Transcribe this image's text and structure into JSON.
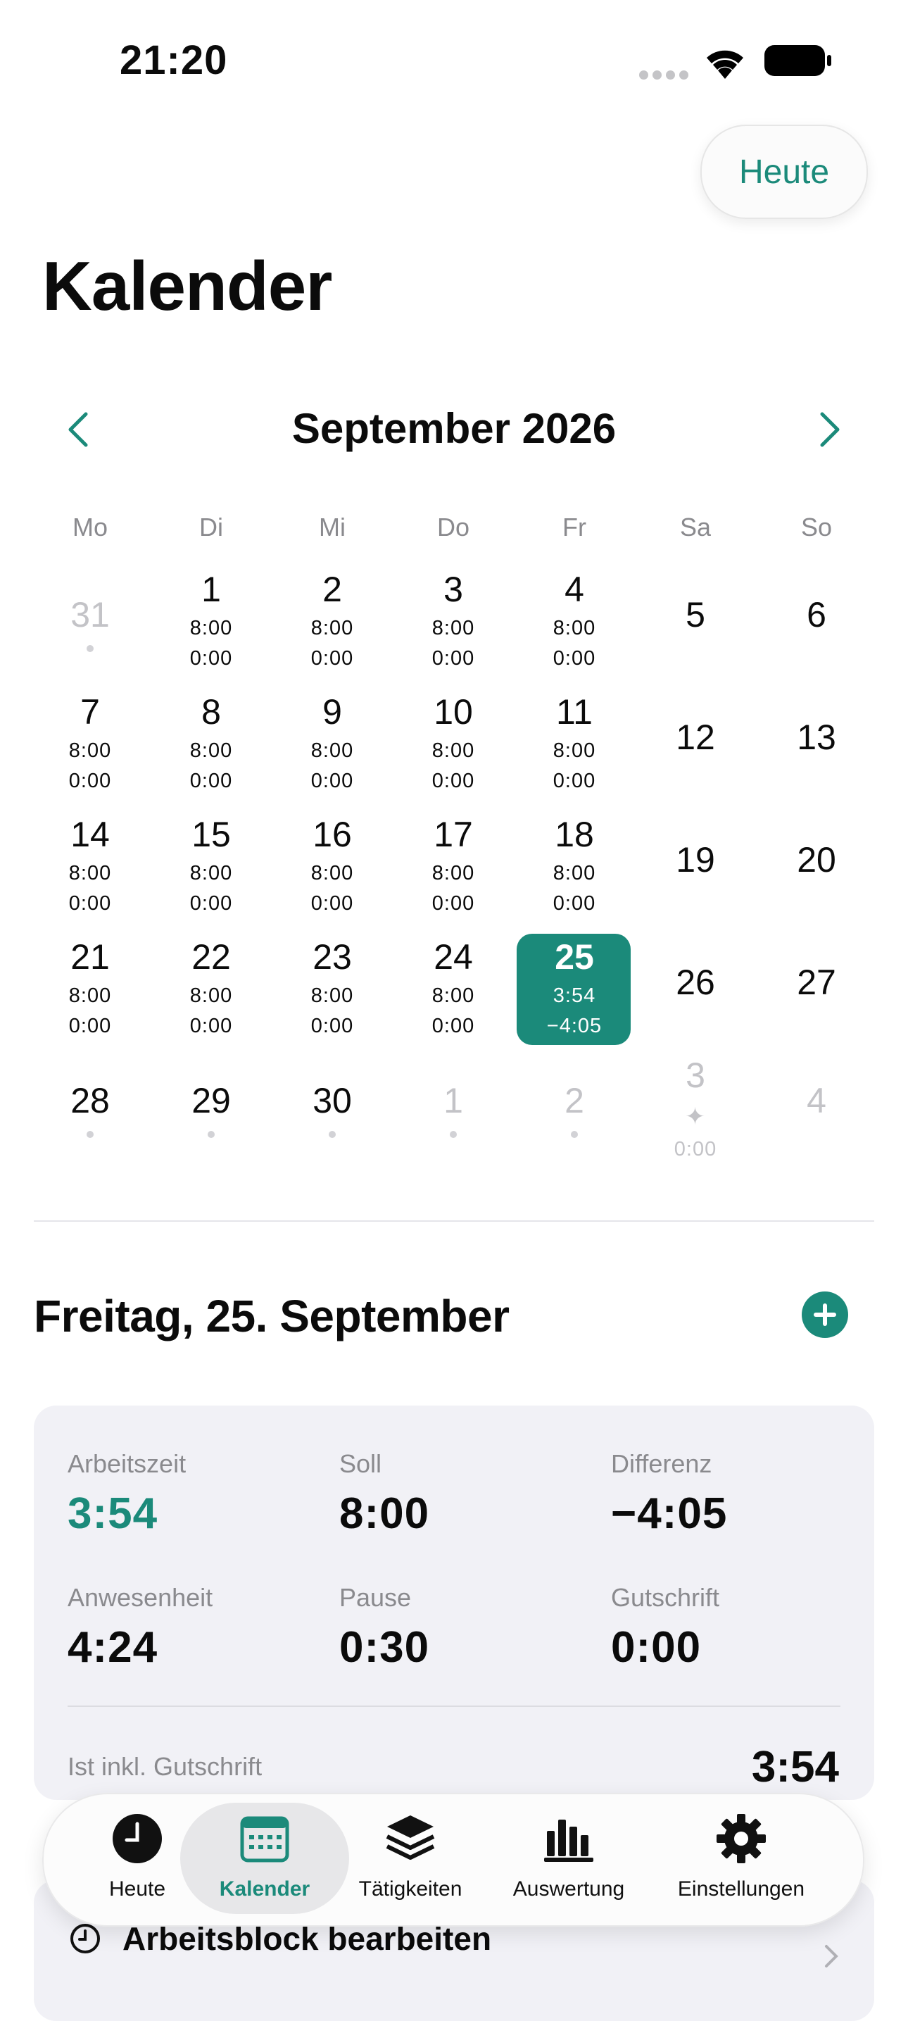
{
  "status_bar": {
    "time": "21:20"
  },
  "header": {
    "today_button": "Heute",
    "title": "Kalender"
  },
  "calendar": {
    "month_label": "September 2026",
    "weekdays": [
      "Mo",
      "Di",
      "Mi",
      "Do",
      "Fr",
      "Sa",
      "So"
    ],
    "weeks": [
      [
        {
          "day": "31",
          "muted": true,
          "dot": true
        },
        {
          "day": "1",
          "target": "8:00",
          "actual": "0:00"
        },
        {
          "day": "2",
          "target": "8:00",
          "actual": "0:00"
        },
        {
          "day": "3",
          "target": "8:00",
          "actual": "0:00"
        },
        {
          "day": "4",
          "target": "8:00",
          "actual": "0:00"
        },
        {
          "day": "5"
        },
        {
          "day": "6"
        }
      ],
      [
        {
          "day": "7",
          "target": "8:00",
          "actual": "0:00"
        },
        {
          "day": "8",
          "target": "8:00",
          "actual": "0:00"
        },
        {
          "day": "9",
          "target": "8:00",
          "actual": "0:00"
        },
        {
          "day": "10",
          "target": "8:00",
          "actual": "0:00"
        },
        {
          "day": "11",
          "target": "8:00",
          "actual": "0:00"
        },
        {
          "day": "12"
        },
        {
          "day": "13"
        }
      ],
      [
        {
          "day": "14",
          "target": "8:00",
          "actual": "0:00"
        },
        {
          "day": "15",
          "target": "8:00",
          "actual": "0:00"
        },
        {
          "day": "16",
          "target": "8:00",
          "actual": "0:00"
        },
        {
          "day": "17",
          "target": "8:00",
          "actual": "0:00"
        },
        {
          "day": "18",
          "target": "8:00",
          "actual": "0:00"
        },
        {
          "day": "19"
        },
        {
          "day": "20"
        }
      ],
      [
        {
          "day": "21",
          "target": "8:00",
          "actual": "0:00"
        },
        {
          "day": "22",
          "target": "8:00",
          "actual": "0:00"
        },
        {
          "day": "23",
          "target": "8:00",
          "actual": "0:00"
        },
        {
          "day": "24",
          "target": "8:00",
          "actual": "0:00"
        },
        {
          "day": "25",
          "target": "3:54",
          "actual": "−4:05",
          "selected": true
        },
        {
          "day": "26"
        },
        {
          "day": "27"
        }
      ],
      [
        {
          "day": "28",
          "dot": true
        },
        {
          "day": "29",
          "dot": true
        },
        {
          "day": "30",
          "dot": true
        },
        {
          "day": "1",
          "muted": true,
          "dot": true
        },
        {
          "day": "2",
          "muted": true,
          "dot": true
        },
        {
          "day": "3",
          "muted": true,
          "sparkle": true,
          "actual": "0:00"
        },
        {
          "day": "4",
          "muted": true
        }
      ]
    ]
  },
  "selected_day": {
    "title": "Freitag, 25. September",
    "stats": [
      {
        "label": "Arbeitszeit",
        "value": "3:54",
        "accent": true
      },
      {
        "label": "Soll",
        "value": "8:00"
      },
      {
        "label": "Differenz",
        "value": "−4:05"
      },
      {
        "label": "Anwesenheit",
        "value": "4:24"
      },
      {
        "label": "Pause",
        "value": "0:30"
      },
      {
        "label": "Gutschrift",
        "value": "0:00"
      }
    ],
    "total_label": "Ist inkl. Gutschrift",
    "total_value": "3:54",
    "edit_block_label": "Arbeitsblock bearbeiten"
  },
  "tabbar": {
    "items": [
      {
        "label": "Heute",
        "icon": "clock-icon"
      },
      {
        "label": "Kalender",
        "icon": "calendar-icon",
        "active": true
      },
      {
        "label": "Tätigkeiten",
        "icon": "layers-icon"
      },
      {
        "label": "Auswertung",
        "icon": "chart-icon"
      },
      {
        "label": "Einstellungen",
        "icon": "gear-icon"
      }
    ]
  },
  "colors": {
    "accent": "#1b8a7a",
    "card_bg": "#f1f1f6",
    "muted_text": "#8a8a8e"
  }
}
